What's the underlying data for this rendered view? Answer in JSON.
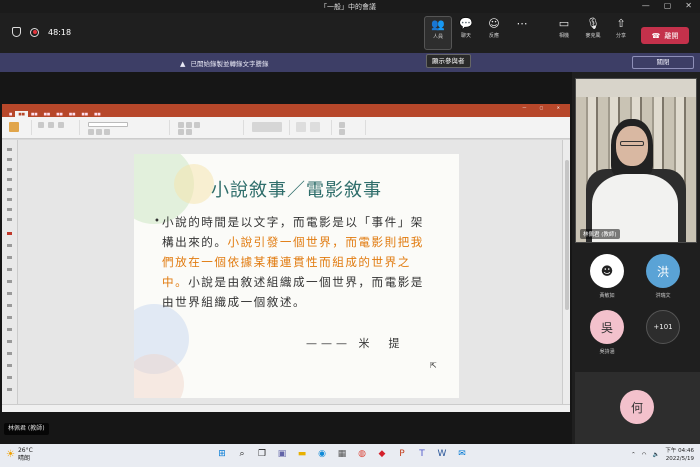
{
  "window": {
    "title": "「一般」中的會議"
  },
  "toolbar": {
    "timer": "48:18",
    "buttons": [
      {
        "label": "人員",
        "icon": "people-icon"
      },
      {
        "label": "聊天",
        "icon": "chat-icon"
      },
      {
        "label": "反應",
        "icon": "reaction-icon"
      },
      {
        "label": "",
        "icon": "more-icon"
      },
      {
        "label": "相機",
        "icon": "camera-off-icon"
      },
      {
        "label": "麥克風",
        "icon": "mic-off-icon"
      },
      {
        "label": "分享",
        "icon": "share-icon"
      }
    ],
    "hangup_label": "離開"
  },
  "banner": {
    "message": "已開始錄製並轉錄文字謄錄",
    "tooltip": "顯示參與者",
    "close_label": "關閉"
  },
  "slide": {
    "title": "小說敘事／電影敘事",
    "body_part1": "小說的時間是以文字，而電影是以「事件」架構出來的。",
    "body_highlight": "小說引發一個世界，而電影則把我們放在一個依據某種連貫性而組成的世界之中。",
    "body_part2": "小說是由敘述組織成一個世界，而電影是由世界組織成一個敘述。",
    "attribution": "——— 米　提"
  },
  "presenter": {
    "name": "林佩君 (教師)"
  },
  "video": {
    "name": "林佩君 (教師)"
  },
  "participants": [
    {
      "name": "黃敏如",
      "initial": "",
      "color": "#ffffff"
    },
    {
      "name": "洪瑞文",
      "initial": "洪",
      "color": "#5aa3d6"
    },
    {
      "name": "吳詩涵",
      "initial": "吳",
      "color": "#f3c1cc"
    },
    {
      "name": "",
      "initial": "+101",
      "color": "#2d2d2d"
    },
    {
      "name": "",
      "initial": "何",
      "color": "#f3c1cc"
    }
  ],
  "taskbar": {
    "temperature": "26°C",
    "weather_label": "晴朗",
    "time": "下午 04:46",
    "date": "2022/5/19"
  }
}
